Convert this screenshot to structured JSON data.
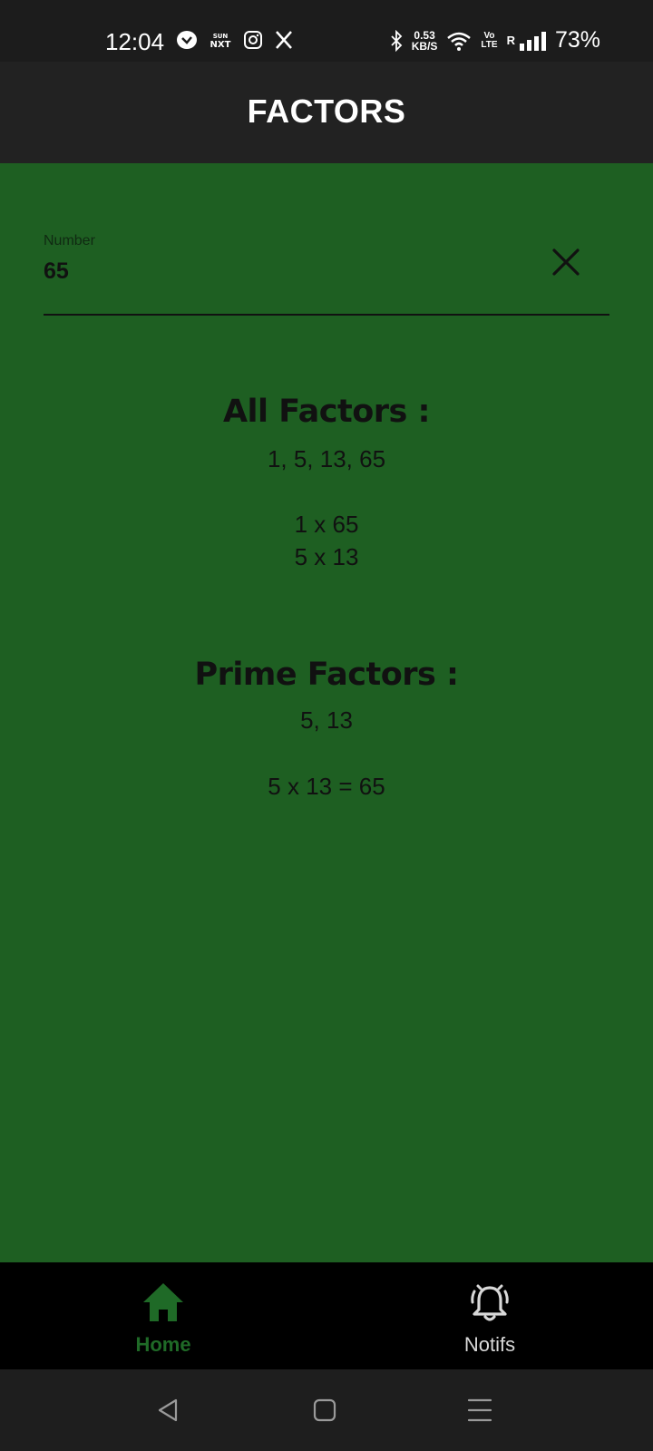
{
  "status_bar": {
    "time": "12:04",
    "net_speed_value": "0.53",
    "net_speed_unit": "KB/S",
    "volte_top": "Vo",
    "volte_bottom": "LTE",
    "roaming": "R",
    "battery": "73%",
    "icons": [
      "viu-icon",
      "sun-nxt-icon",
      "instagram-icon",
      "x-icon",
      "bluetooth-icon",
      "wifi-icon",
      "signal-icon"
    ]
  },
  "app_bar": {
    "title": "FACTORS"
  },
  "input": {
    "label": "Number",
    "value": "65"
  },
  "all_factors": {
    "title": "All Factors :",
    "list": "1, 5, 13, 65",
    "pairs": [
      "1 x 65",
      "5 x 13"
    ]
  },
  "prime_factors": {
    "title": "Prime Factors :",
    "list": "5, 13",
    "equation": "5 x 13 = 65"
  },
  "bottom_nav": {
    "items": [
      {
        "label": "Home",
        "icon": "home-icon",
        "active": true
      },
      {
        "label": "Notifs",
        "icon": "bell-icon",
        "active": false
      }
    ]
  },
  "colors": {
    "background": "#1e5f22",
    "app_bar": "#222222",
    "status_bar": "#1c1c1c",
    "bottom_nav": "#000000",
    "active_tab": "#1f6a27"
  }
}
